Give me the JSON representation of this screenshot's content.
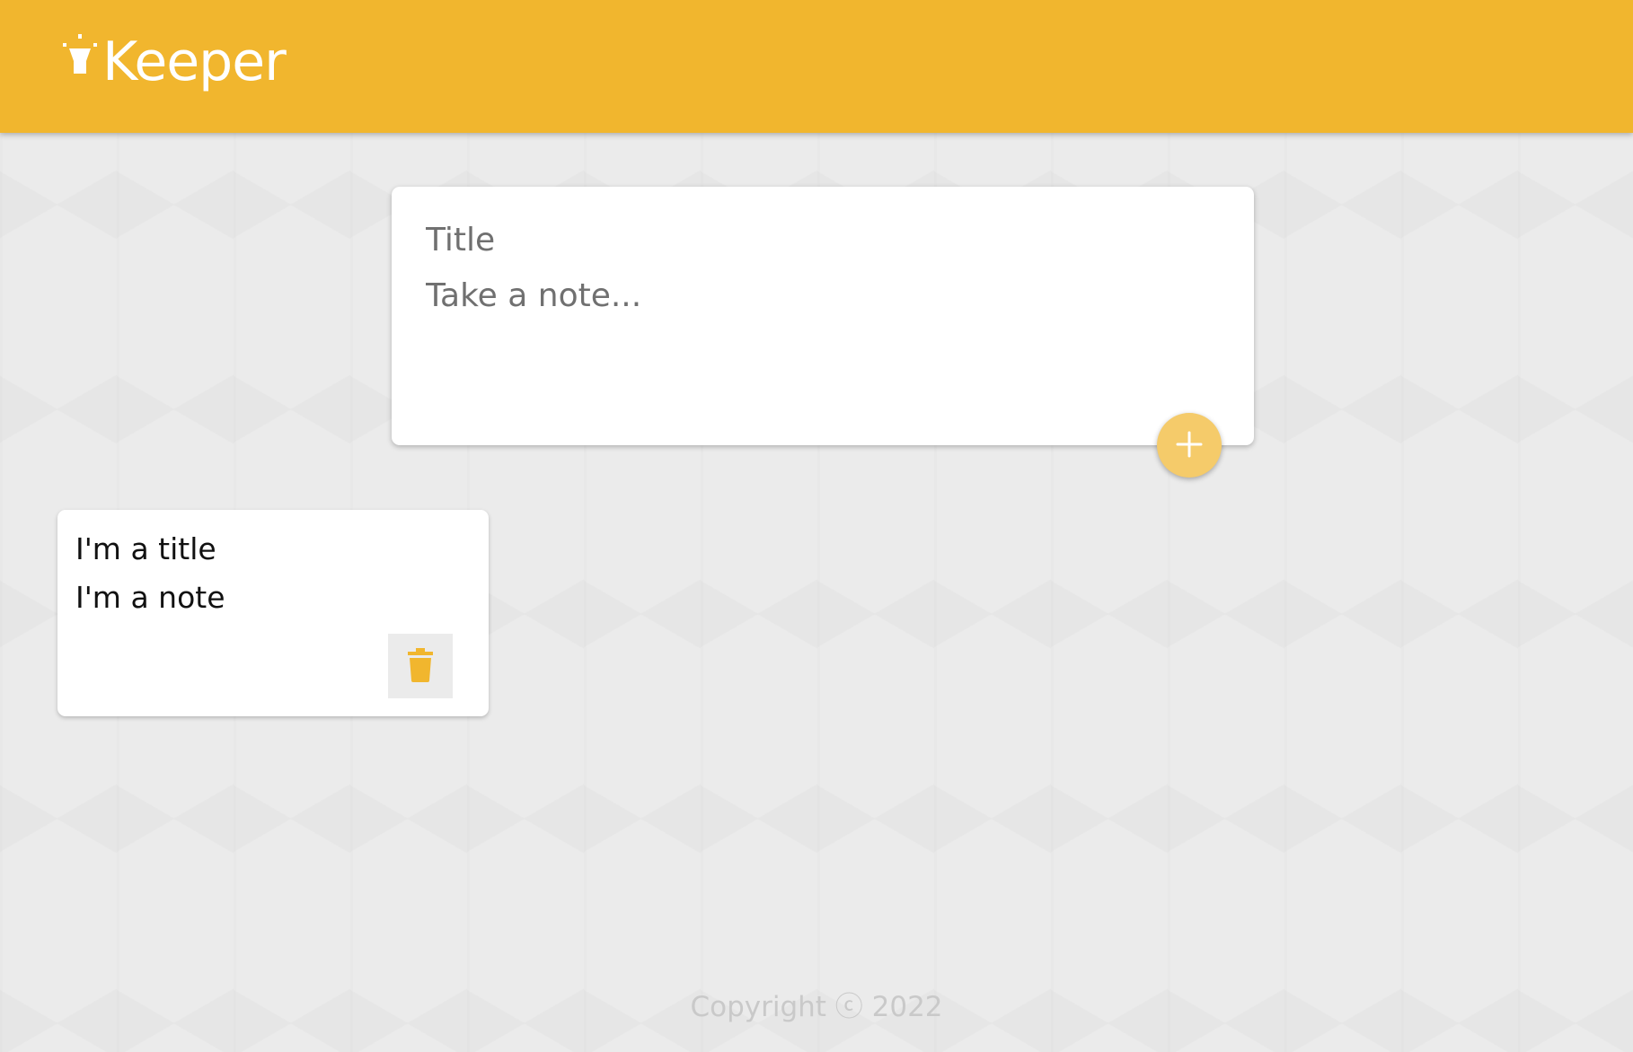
{
  "header": {
    "app_name": "Keeper",
    "logo_icon": "lightbulb-icon",
    "background_color": "#f1b62e"
  },
  "compose": {
    "title_placeholder": "Title",
    "content_placeholder": "Take a note...",
    "add_icon": "plus-icon",
    "add_button_color": "#f5cb6a"
  },
  "notes": [
    {
      "title": "I'm a title",
      "content": "I'm a note",
      "delete_icon": "trash-icon",
      "delete_icon_color": "#f1b62e"
    }
  ],
  "footer": {
    "copyright": "Copyright ⓒ 2022"
  },
  "colors": {
    "page_background": "#ebebeb",
    "accent": "#f1b62e"
  }
}
